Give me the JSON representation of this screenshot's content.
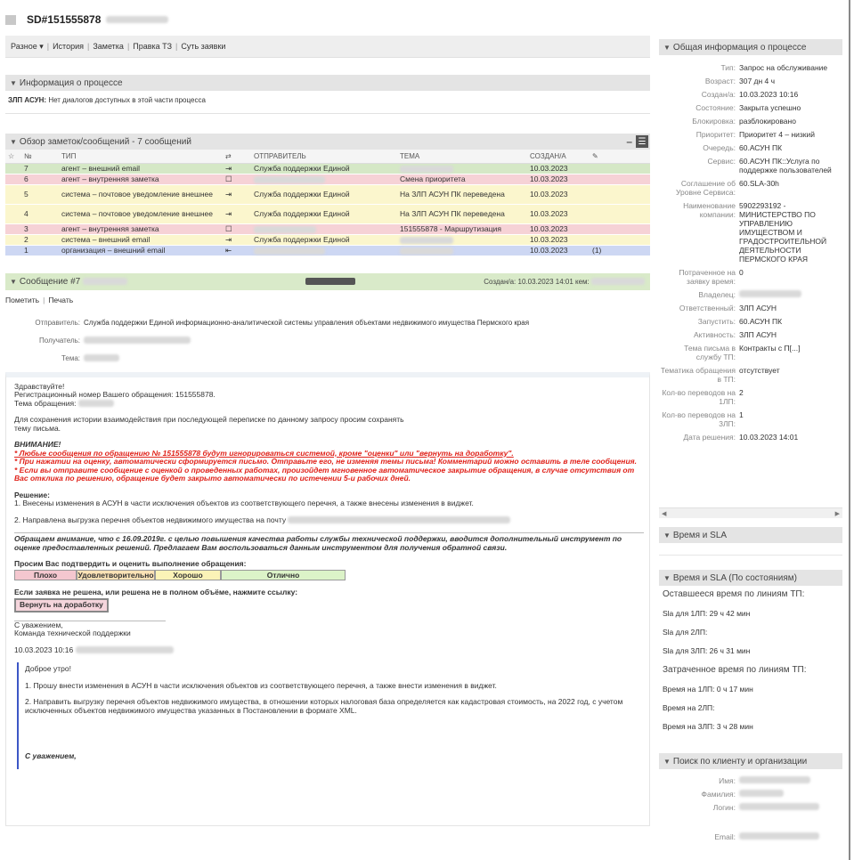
{
  "header": {
    "ticket": "SD#151555878"
  },
  "menu": {
    "items": [
      "Разное ▾",
      "История",
      "Заметка",
      "Правка ТЗ",
      "Суть заявки"
    ]
  },
  "process_info": {
    "title": "Информация о процессе",
    "label": "ЗЛП АСУН:",
    "text": "Нет диалогов доступных в этой части процесса"
  },
  "notes": {
    "title": "Обзор заметок/сообщений - 7 сообщений",
    "columns": [
      "№",
      "ТИП",
      "⇄",
      "ОТПРАВИТЕЛЬ",
      "ТЕМА",
      "СОЗДАН/А",
      "✎"
    ],
    "rows": [
      {
        "n": "7",
        "type": "агент – внешний email",
        "sender": "Служба поддержки Единой",
        "subject": "",
        "date": "10.03.2023",
        "att": ""
      },
      {
        "n": "6",
        "type": "агент – внутренняя заметка",
        "sender": "",
        "subject": "Смена приоритета",
        "date": "10.03.2023",
        "att": ""
      },
      {
        "n": "5",
        "type": "система – почтовое уведомление внешнее",
        "sender": "Служба поддержки Единой",
        "subject": "На ЗЛП АСУН ПК переведена",
        "date": "10.03.2023",
        "att": ""
      },
      {
        "n": "4",
        "type": "система – почтовое уведомление внешнее",
        "sender": "Служба поддержки Единой",
        "subject": "На ЗЛП АСУН ПК переведена",
        "date": "10.03.2023",
        "att": ""
      },
      {
        "n": "3",
        "type": "агент – внутренняя заметка",
        "sender": "",
        "subject": "151555878 - Маршрутизация",
        "date": "10.03.2023",
        "att": ""
      },
      {
        "n": "2",
        "type": "система – внешний email",
        "sender": "Служба поддержки Единой",
        "subject": "",
        "date": "10.03.2023",
        "att": ""
      },
      {
        "n": "1",
        "type": "организация – внешний email",
        "sender": "",
        "subject": "",
        "date": "10.03.2023",
        "att": "(1)"
      }
    ]
  },
  "message": {
    "title": "Сообщение #7",
    "created": "Создан/а: 10.03.2023 14:01 кем:",
    "actions": [
      "Пометить",
      "Печать"
    ],
    "sender_label": "Отправитель:",
    "sender": "Служба поддержки Единой информационно-аналитической системы управления объектами недвижимого имущества Пермского края",
    "recipient_label": "Получатель:",
    "subject_label": "Тема:",
    "body": {
      "greet": "Здравствуйте!",
      "reg": "Регистрационный номер Вашего обращения: 151555878.",
      "subj": "Тема обращения:",
      "keep": "Для сохранения истории взаимодействия при последующей переписке по данному запросу просим сохранять тему письма.",
      "attn": "ВНИМАНИЕ!",
      "w1": "* Любые сообщения  по обращению № 151555878  будут игнорироваться системой, кроме \"оценки\" или \"вернуть на доработку\".",
      "w2": "* При нажатии на оценку, автоматически сформируется письмо. Отправьте его, не изменяя темы письма! Комментарий можно оставить в теле сообщения.",
      "w3": "* Если вы отправите сообщение с оценкой о проведенных работах, произойдет мгновенное автоматическое закрытие обращения, в случае отсутствия от Вас отклика по решению, обращение будет закрыто автоматически по истечении 5-и рабочих дней.",
      "sol": "Решение:",
      "s1": "1. Внесены изменения в АСУН в части исключения объектов из соответствующего перечня, а также внесены изменения в виджет.",
      "s2": "2. Направлена выгрузка перечня объектов недвижимого имущества на почту",
      "notice": "Обращаем внимание, что с 16.09.2019г. с целью повышения качества работы службы технической поддержки, вводится дополнительный инструмент по оценке предоставленных решений. Предлагаем Вам воспользоваться данным инструментом для получения обратной связи.",
      "confirm": "Просим Вас подтвердить и оценить выполнение обращения:",
      "r1": "Плохо",
      "r2": "Удовлетворительно",
      "r3": "Хорошо",
      "r4": "Отлично",
      "ifnot": "Если заявка не решена, или решена не в полном объёме, нажмите ссылку:",
      "ret": "Вернуть на доработку",
      "regards": "С уважением,",
      "team": "Команда технической поддержки",
      "qdate": "10.03.2023 10:16",
      "q1": "Доброе утро!",
      "q2": "1. Прошу внести изменения в АСУН в части исключения объектов из соответствующего перечня, а также внести изменения в виджет.",
      "q3": "2. Направить выгрузку перечня объектов недвижимого имущества, в отношении которых налоговая база определяется как кадастровая стоимость, на 2022 год, с учетом исключенных объектов недвижимого имущества указанных в Постановлении в формате XML.",
      "q4": "С уважением,"
    }
  },
  "side": {
    "general_title": "Общая информация о процессе",
    "fields": [
      {
        "k": "Тип:",
        "v": "Запрос на обслуживание"
      },
      {
        "k": "Возраст:",
        "v": "307 дн 4 ч"
      },
      {
        "k": "Создан/а:",
        "v": "10.03.2023 10:16"
      },
      {
        "k": "Состояние:",
        "v": "Закрыта успешно"
      },
      {
        "k": "Блокировка:",
        "v": "разблокировано"
      },
      {
        "k": "Приоритет:",
        "v": "Приоритет 4 – низкий"
      },
      {
        "k": "Очередь:",
        "v": "60.АСУН ПК"
      },
      {
        "k": "Сервис:",
        "v": "60.АСУН ПК::Услуга по поддержке пользователей"
      },
      {
        "k": "Соглашение об Уровне Сервиса:",
        "v": "60.SLA-30h"
      },
      {
        "k": "Наименование компании:",
        "v": "5902293192 - МИНИСТЕРСТВО ПО УПРАВЛЕНИЮ ИМУЩЕСТВОМ И ГРАДОСТРОИТЕЛЬНОЙ ДЕЯТЕЛЬНОСТИ ПЕРМСКОГО КРАЯ",
        "orange": true
      },
      {
        "k": "Потраченное на заявку время:",
        "v": "0"
      },
      {
        "k": "Владелец:",
        "v": ""
      },
      {
        "k": "Ответственный:",
        "v": "ЗЛП АСУН"
      },
      {
        "k": "Запустить:",
        "v": "60.АСУН ПК"
      },
      {
        "k": "Активность:",
        "v": "ЗЛП АСУН"
      },
      {
        "k": "Тема письма в службу ТП:",
        "v": "Контракты с П[...]"
      },
      {
        "k": "Тематика обращения в ТП:",
        "v": "отсутствует"
      },
      {
        "k": "Кол-во переводов на 1ЛП:",
        "v": "2"
      },
      {
        "k": "Кол-во переводов на 3ЛП:",
        "v": "1"
      },
      {
        "k": "Дата решения:",
        "v": "10.03.2023 14:01"
      }
    ],
    "sla_title": "Время и SLA",
    "sla_state_title": "Время и SLA (По состояниям)",
    "sla": [
      "Оставшееся время по линиям ТП:",
      "Sla для 1ЛП: 29 ч 42 мин",
      "Sla для 2ЛП:",
      "Sla для 3ЛП: 26 ч 31 мин",
      "Затраченное время по линиям ТП:",
      "Время на 1ЛП: 0 ч 17 мин",
      "Время на 2ЛП:",
      "Время на 3ЛП: 3 ч 28 мин"
    ],
    "search_title": "Поиск по клиенту и организации",
    "search_fields": [
      "Имя:",
      "Фамилия:",
      "Логин:",
      "Email:"
    ]
  }
}
